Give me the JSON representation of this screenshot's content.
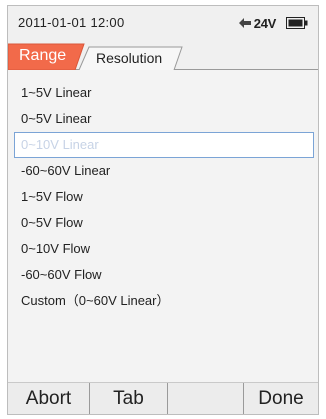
{
  "status": {
    "datetime": "2011-01-01 12:00",
    "voltage": "24V",
    "power_icon": "plug-icon",
    "battery_icon": "battery-icon"
  },
  "tabs": [
    {
      "label": "Range",
      "active": true
    },
    {
      "label": "Resolution",
      "active": false
    }
  ],
  "range_list": {
    "items": [
      "1~5V Linear",
      "0~5V Linear",
      "0~10V Linear",
      "-60~60V Linear",
      "1~5V Flow",
      "0~5V Flow",
      "0~10V Flow",
      "-60~60V Flow",
      "Custom（0~60V Linear）"
    ],
    "selected_index": 2
  },
  "softkeys": [
    "Abort",
    "Tab",
    "",
    "Done"
  ],
  "colors": {
    "active_tab": "#f26a4a",
    "selection_border": "#7ba4d6",
    "selection_text": "#c7d3e6"
  }
}
